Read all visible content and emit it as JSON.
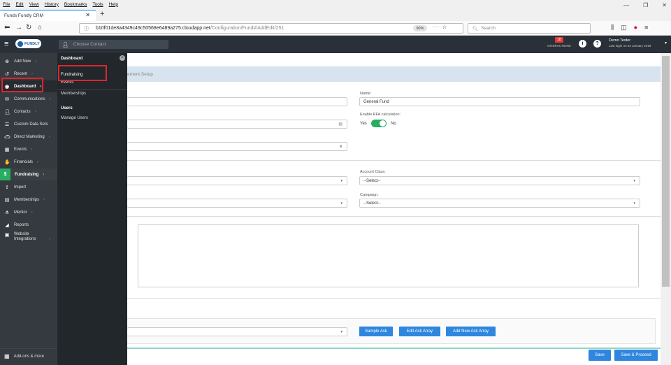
{
  "browser": {
    "menu": [
      "File",
      "Edit",
      "View",
      "History",
      "Bookmarks",
      "Tools",
      "Help"
    ],
    "tab_title": "Funds Fundly CRM",
    "url_prefix": "b10f01de8a4349c49c50568e6489a275.cloudapp.net",
    "url_path": "/Configuration/Fund#/AddEdit/251",
    "zoom": "90%",
    "search_placeholder": "Search"
  },
  "header": {
    "logo_text": "FUNDLY",
    "contact_placeholder": "Choose Contact",
    "interactions_count": "18",
    "interactions_label": "INTERACTIONS",
    "user_name": "Demo Tester",
    "last_login": "Last login on 03 January 2019"
  },
  "nav": {
    "items": [
      {
        "label": "Add New",
        "icon": "plus-circle-icon"
      },
      {
        "label": "Recent",
        "icon": "history-icon"
      },
      {
        "label": "Dashboard",
        "icon": "dashboard-icon"
      },
      {
        "label": "Communications",
        "icon": "envelope-icon"
      },
      {
        "label": "Contacts",
        "icon": "user-icon"
      },
      {
        "label": "Custom Data Sets",
        "icon": "database-icon"
      },
      {
        "label": "Direct Marketing",
        "icon": "car-icon"
      },
      {
        "label": "Events",
        "icon": "calendar-icon"
      },
      {
        "label": "Financials",
        "icon": "handshake-icon"
      },
      {
        "label": "Fundraising",
        "icon": "money-bag-icon"
      },
      {
        "label": "Import",
        "icon": "upload-icon"
      },
      {
        "label": "Memberships",
        "icon": "id-card-icon"
      },
      {
        "label": "Mentor",
        "icon": "network-icon"
      },
      {
        "label": "Reports",
        "icon": "chart-icon"
      },
      {
        "label": "Website Integrations",
        "icon": "browser-icon"
      }
    ],
    "addons": "Add-ons & more"
  },
  "flyout": {
    "heading": "Dashboard",
    "items": [
      "Fundraising",
      "Events",
      "Memberships"
    ],
    "section": "Users",
    "section_items": [
      "Manage Users"
    ]
  },
  "page": {
    "tab_fragment": "ement Setup",
    "name_label": "Name:",
    "name_value": "General Fund",
    "rfa_label": "Enable RFA calculation:",
    "yes": "Yes",
    "no": "No",
    "account_class_label": "Account Class:",
    "account_class_value": "--Select--",
    "campaign_label": "Campaign:",
    "campaign_value": "--Select--",
    "buttons": {
      "sample_ask": "Sample Ask",
      "edit_ask_array": "Edit Ask Array",
      "add_new_ask_array": "Add New Ask Array",
      "save": "Save",
      "save_proceed": "Save & Proceed"
    }
  },
  "colors": {
    "accent": "#2e86de",
    "nav_bg": "#343a40",
    "flyout_bg": "#22272c",
    "highlight": "#e0242e",
    "toggle_on": "#27ae60"
  }
}
